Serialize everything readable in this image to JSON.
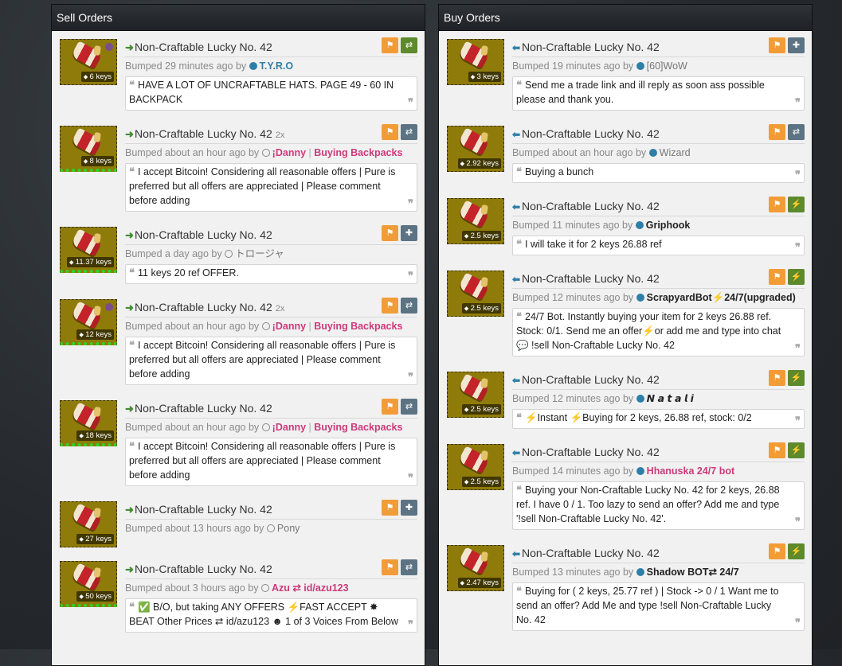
{
  "sell": {
    "title": "Sell Orders",
    "orders": [
      {
        "item": "Non-Craftable Lucky No. 42",
        "qty": "",
        "price": "6 keys",
        "bumped": "Bumped 29 minutes ago by",
        "user": "T.Y.R.O",
        "user_style": "blue",
        "status": "filled",
        "btn2": "swap-icon",
        "btn2_color": "green",
        "paint": true,
        "dots": false,
        "comment": "HAVE A LOT OF UNCRAFTABLE HATS. PAGE 49 - 60 IN BACKPACK"
      },
      {
        "item": "Non-Craftable Lucky No. 42",
        "qty": "2x",
        "price": "8 keys",
        "bumped": "Bumped about an hour ago by",
        "user": "¡Danny",
        "user_extra": "Buying Backpacks",
        "user_style": "pink",
        "status": "hollow",
        "btn2": "swap-icon",
        "btn2_color": "slate",
        "paint": false,
        "dots": true,
        "comment": "I accept Bitcoin! Considering all reasonable offers | Pure is preferred but all offers are appreciated | Please comment before adding"
      },
      {
        "item": "Non-Craftable Lucky No. 42",
        "qty": "",
        "price": "11.37 keys",
        "bumped": "Bumped a day ago by",
        "user": "トロージャ",
        "user_style": "plain",
        "status": "hollow",
        "btn2": "add-friend-icon",
        "btn2_color": "slate",
        "paint": false,
        "dots": true,
        "comment": "11 keys 20 ref OFFER."
      },
      {
        "item": "Non-Craftable Lucky No. 42",
        "qty": "2x",
        "price": "12 keys",
        "bumped": "Bumped about an hour ago by",
        "user": "¡Danny",
        "user_extra": "Buying Backpacks",
        "user_style": "pink",
        "status": "hollow",
        "btn2": "swap-icon",
        "btn2_color": "slate",
        "paint": true,
        "dots": true,
        "comment": "I accept Bitcoin! Considering all reasonable offers | Pure is preferred but all offers are appreciated | Please comment before adding"
      },
      {
        "item": "Non-Craftable Lucky No. 42",
        "qty": "",
        "price": "18 keys",
        "bumped": "Bumped about an hour ago by",
        "user": "¡Danny",
        "user_extra": "Buying Backpacks",
        "user_style": "pink",
        "status": "hollow",
        "btn2": "swap-icon",
        "btn2_color": "slate",
        "paint": false,
        "dots": true,
        "comment": "I accept Bitcoin! Considering all reasonable offers | Pure is preferred but all offers are appreciated | Please comment before adding"
      },
      {
        "item": "Non-Craftable Lucky No. 42",
        "qty": "",
        "price": "27 keys",
        "bumped": "Bumped about 13 hours ago by",
        "user": "Pony",
        "user_style": "plain",
        "status": "hollow",
        "btn2": "add-friend-icon",
        "btn2_color": "slate",
        "paint": false,
        "dots": false,
        "comment": ""
      },
      {
        "item": "Non-Craftable Lucky No. 42",
        "qty": "",
        "price": "50 keys",
        "bumped": "Bumped about 3 hours ago by",
        "user": "Azu ⇄ id/azu123",
        "user_style": "pink",
        "status": "hollow",
        "btn2": "swap-icon",
        "btn2_color": "slate",
        "paint": false,
        "dots": true,
        "comment": "✅ B/O, but taking ANY OFFERS ⚡FAST ACCEPT ✸ BEAT Other Prices ⇄ id/azu123 ☻ 1 of 3 Voices From Below"
      }
    ]
  },
  "buy": {
    "title": "Buy Orders",
    "orders": [
      {
        "item": "Non-Craftable Lucky No. 42",
        "price": "3 keys",
        "bumped": "Bumped 19 minutes ago by",
        "user": "[60]WoW",
        "user_style": "plain",
        "status": "filled",
        "btn2": "add-friend-icon",
        "btn2_color": "slate",
        "comment": "Send me a trade link and ill reply as soon ass possible please and thank you."
      },
      {
        "item": "Non-Craftable Lucky No. 42",
        "price": "2.92 keys",
        "bumped": "Bumped about an hour ago by",
        "user": "Wizard",
        "user_style": "plain",
        "status": "filled",
        "btn2": "swap-icon",
        "btn2_color": "slate",
        "comment": "Buying a bunch"
      },
      {
        "item": "Non-Craftable Lucky No. 42",
        "price": "2.5 keys",
        "bumped": "Bumped 11 minutes ago by",
        "user": "Griphook",
        "user_style": "dark",
        "status": "filled",
        "btn2": "bolt-icon",
        "btn2_color": "green",
        "comment": "I will take it for 2 keys 26.88 ref"
      },
      {
        "item": "Non-Craftable Lucky No. 42",
        "price": "2.5 keys",
        "bumped": "Bumped 12 minutes ago by",
        "user": "ScrapyardBot⚡24/7(upgraded)",
        "user_style": "dark",
        "status": "filled",
        "btn2": "bolt-icon",
        "btn2_color": "green",
        "comment": "24/7 Bot. Instantly buying your item for 2 keys 26.88 ref. Stock: 0/1. Send me an offer⚡or add me and type into chat💬 !sell Non-Craftable Lucky No. 42"
      },
      {
        "item": "Non-Craftable Lucky No. 42",
        "price": "2.5 keys",
        "bumped": "Bumped 12 minutes ago by",
        "user": "𝙉 𝙖 𝙩 𝙖 𝙡 𝙞",
        "user_style": "dark",
        "status": "filled",
        "btn2": "bolt-icon",
        "btn2_color": "green",
        "comment": "⚡Instant ⚡Buying for 2 keys, 26.88 ref, stock: 0/2"
      },
      {
        "item": "Non-Craftable Lucky No. 42",
        "price": "2.5 keys",
        "bumped": "Bumped 14 minutes ago by",
        "user": "Hhanuska 24/7 bot",
        "user_style": "pink",
        "status": "filled",
        "btn2": "bolt-icon",
        "btn2_color": "green",
        "comment": "Buying your Non-Craftable Lucky No. 42 for 2 keys, 26.88 ref. I have 0 / 1. Too lazy to send an offer? Add me and type '!sell Non-Craftable Lucky No. 42'."
      },
      {
        "item": "Non-Craftable Lucky No. 42",
        "price": "2.47 keys",
        "bumped": "Bumped 13 minutes ago by",
        "user": "Shadow BOT⇄ 24/7",
        "user_style": "dark",
        "status": "filled",
        "btn2": "bolt-icon",
        "btn2_color": "green",
        "comment": "Buying for ( 2 keys, 25.77 ref ) | Stock -> 0 / 1 Want me to send an offer? Add Me and type !sell Non-Craftable Lucky No. 42"
      }
    ]
  },
  "icons": {
    "flag-icon": "⚑",
    "swap-icon": "⇄",
    "add-friend-icon": "✚",
    "bolt-icon": "⚡",
    "price-tag-icon": "🏷",
    "quote-open": "❝",
    "quote-close": "❞"
  }
}
